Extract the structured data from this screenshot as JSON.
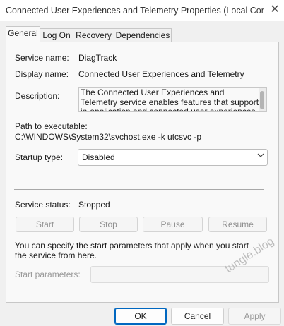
{
  "window": {
    "title": "Connected User Experiences and Telemetry Properties (Local Comp...",
    "close_glyph": "✕"
  },
  "tabs": [
    {
      "label": "General",
      "active": true
    },
    {
      "label": "Log On",
      "active": false
    },
    {
      "label": "Recovery",
      "active": false
    },
    {
      "label": "Dependencies",
      "active": false
    }
  ],
  "general": {
    "service_name_label": "Service name:",
    "service_name": "DiagTrack",
    "display_name_label": "Display name:",
    "display_name": "Connected User Experiences and Telemetry",
    "description_label": "Description:",
    "description": "The Connected User Experiences and Telemetry service enables features that support in-application and connected user experiences. Additionally, this",
    "path_label": "Path to executable:",
    "path": "C:\\WINDOWS\\System32\\svchost.exe -k utcsvc -p",
    "startup_type_label": "Startup type:",
    "startup_type": "Disabled",
    "service_status_label": "Service status:",
    "service_status": "Stopped",
    "buttons": {
      "start": "Start",
      "stop": "Stop",
      "pause": "Pause",
      "resume": "Resume"
    },
    "info_text": "You can specify the start parameters that apply when you start the service from here.",
    "start_parameters_label": "Start parameters:",
    "start_parameters_value": ""
  },
  "footer": {
    "ok": "OK",
    "cancel": "Cancel",
    "apply": "Apply"
  },
  "watermark": "tungle.blog",
  "colors": {
    "accent": "#0067c0",
    "window_bg": "#f0f0f0",
    "panel_bg": "#f9f9f9"
  }
}
